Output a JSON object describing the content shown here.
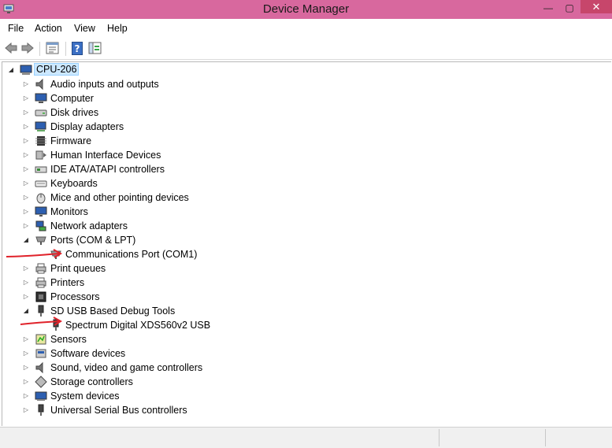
{
  "window": {
    "title": "Device Manager",
    "minimize_glyph": "—",
    "maximize_glyph": "▢",
    "close_glyph": "✕"
  },
  "menu": [
    "File",
    "Action",
    "View",
    "Help"
  ],
  "toolbar": {
    "buttons": [
      "back-arrow-icon",
      "forward-arrow-icon",
      "properties-icon",
      "help-icon",
      "show-hide-icon"
    ]
  },
  "tree": {
    "root": "CPU-206",
    "categories": [
      {
        "label": "Audio inputs and outputs",
        "icon": "speaker-icon"
      },
      {
        "label": "Computer",
        "icon": "computer-icon"
      },
      {
        "label": "Disk drives",
        "icon": "disk-drive-icon"
      },
      {
        "label": "Display adapters",
        "icon": "display-adapter-icon"
      },
      {
        "label": "Firmware",
        "icon": "chip-icon"
      },
      {
        "label": "Human Interface Devices",
        "icon": "hid-icon"
      },
      {
        "label": "IDE ATA/ATAPI controllers",
        "icon": "ide-controller-icon"
      },
      {
        "label": "Keyboards",
        "icon": "keyboard-icon"
      },
      {
        "label": "Mice and other pointing devices",
        "icon": "mouse-icon"
      },
      {
        "label": "Monitors",
        "icon": "monitor-icon"
      },
      {
        "label": "Network adapters",
        "icon": "network-icon"
      },
      {
        "label": "Ports (COM & LPT)",
        "icon": "port-icon",
        "expanded": true,
        "children": [
          {
            "label": "Communications Port (COM1)",
            "icon": "port-icon"
          }
        ]
      },
      {
        "label": "Print queues",
        "icon": "printer-icon"
      },
      {
        "label": "Printers",
        "icon": "printer-icon"
      },
      {
        "label": "Processors",
        "icon": "processor-icon"
      },
      {
        "label": "SD USB Based Debug Tools",
        "icon": "usb-plug-icon",
        "expanded": true,
        "children": [
          {
            "label": "Spectrum Digital XDS560v2 USB",
            "icon": "usb-plug-icon"
          }
        ]
      },
      {
        "label": "Sensors",
        "icon": "sensor-icon"
      },
      {
        "label": "Software devices",
        "icon": "software-device-icon"
      },
      {
        "label": "Sound, video and game controllers",
        "icon": "speaker-icon"
      },
      {
        "label": "Storage controllers",
        "icon": "storage-controller-icon"
      },
      {
        "label": "System devices",
        "icon": "system-device-icon"
      },
      {
        "label": "Universal Serial Bus controllers",
        "icon": "usb-plug-icon"
      }
    ]
  },
  "colors": {
    "titlebar": "#d8689e",
    "close_button": "#c7466b",
    "selection": "#cce8ff",
    "annotation_arrow": "#e0222a"
  }
}
